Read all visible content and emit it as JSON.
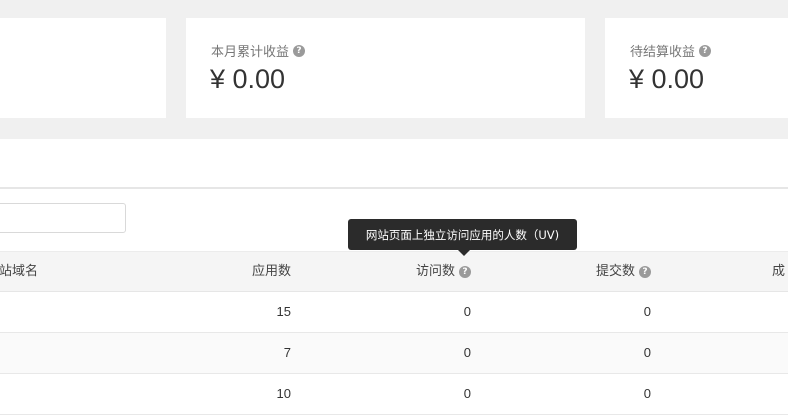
{
  "cards": [
    {
      "label": "",
      "value": ""
    },
    {
      "label": "本月累计收益",
      "value": "¥ 0.00"
    },
    {
      "label": "待结算收益",
      "value": "¥ 0.00"
    }
  ],
  "table": {
    "headers": {
      "domain": "站域名",
      "apps": "应用数",
      "visits": "访问数",
      "submissions": "提交数",
      "success": "成"
    },
    "rows": [
      {
        "apps": "15",
        "visits": "0",
        "submissions": "0"
      },
      {
        "apps": "7",
        "visits": "0",
        "submissions": "0"
      },
      {
        "apps": "10",
        "visits": "0",
        "submissions": "0"
      }
    ]
  },
  "tooltip": {
    "text": "网站页面上独立访问应用的人数（UV)"
  },
  "icons": {
    "help": "question-circle-icon"
  },
  "colors": {
    "page_bg": "#f0f0f0",
    "tooltip_bg": "#2b2b2b"
  }
}
